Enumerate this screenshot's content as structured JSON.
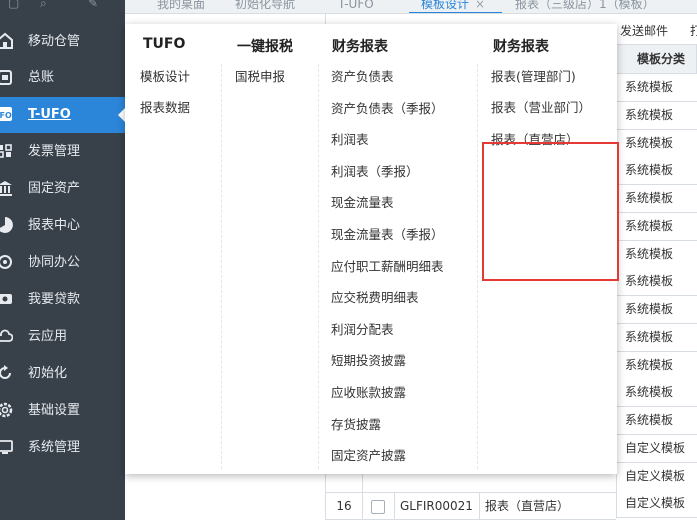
{
  "tabs": [
    {
      "label": "我的桌面"
    },
    {
      "label": "初始化导航"
    },
    {
      "label": "T-UFO"
    },
    {
      "label": "模板设计"
    },
    {
      "label": "报表（三级店）1（模板）"
    }
  ],
  "tab_close_glyph": "×",
  "sidebar": {
    "items": [
      {
        "label": "移动仓管",
        "icon": "warehouse-icon"
      },
      {
        "label": "总账",
        "icon": "ledger-icon"
      },
      {
        "label": "T-UFO",
        "icon": "ufo-icon"
      },
      {
        "label": "发票管理",
        "icon": "invoice-icon"
      },
      {
        "label": "固定资产",
        "icon": "asset-icon"
      },
      {
        "label": "报表中心",
        "icon": "report-icon"
      },
      {
        "label": "协同办公",
        "icon": "collab-icon"
      },
      {
        "label": "我要贷款",
        "icon": "loan-icon"
      },
      {
        "label": "云应用",
        "icon": "cloud-icon"
      },
      {
        "label": "初始化",
        "icon": "init-icon"
      },
      {
        "label": "基础设置",
        "icon": "settings-icon"
      },
      {
        "label": "系统管理",
        "icon": "system-icon"
      }
    ],
    "active_index": 2
  },
  "toolbar": {
    "send_mail": "发送邮件",
    "extra": "打"
  },
  "table": {
    "type_header": "模板分类",
    "type_values": [
      "系统模板",
      "系统模板",
      "系统模板",
      "系统模板",
      "系统模板",
      "系统模板",
      "系统模板",
      "系统模板",
      "系统模板",
      "系统模板",
      "系统模板",
      "系统模板",
      "系统模板",
      "自定义模板",
      "自定义模板",
      "自定义模板"
    ],
    "rows": [
      {
        "num": "16",
        "code": "GLFIR00021",
        "name": "报表（直营店）"
      }
    ]
  },
  "menu": {
    "columns": [
      {
        "title": "TUFO",
        "items": [
          "模板设计",
          "报表数据"
        ]
      },
      {
        "title": "一键报税",
        "items": [
          "国税申报"
        ]
      },
      {
        "title": "财务报表",
        "items": [
          "资产负债表",
          "资产负债表（季报）",
          "利润表",
          "利润表（季报）",
          "现金流量表",
          "现金流量表（季报）",
          "应付职工薪酬明细表",
          "应交税费明细表",
          "利润分配表",
          "短期投资披露",
          "应收账款披露",
          "存货披露",
          "固定资产披露"
        ]
      },
      {
        "title": "财务报表",
        "items": [
          "报表(管理部门)",
          "报表（营业部门）",
          "报表（直营店）"
        ]
      }
    ]
  },
  "colors": {
    "sidebar_bg": "#38404a",
    "accent": "#2b86d9",
    "highlight_box": "#e53935"
  }
}
